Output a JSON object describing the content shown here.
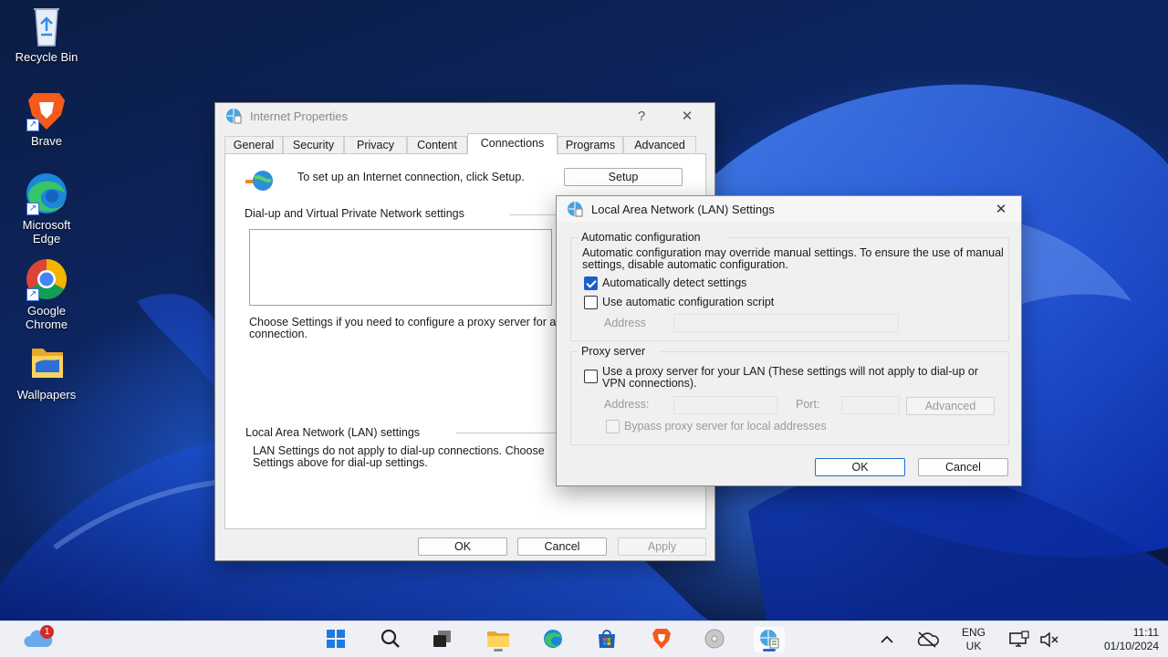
{
  "desktop": {
    "icons": [
      {
        "label": "Recycle Bin",
        "icon": "recycle-bin-icon"
      },
      {
        "label": "Brave",
        "icon": "brave-icon"
      },
      {
        "label": "Microsoft Edge",
        "icon": "edge-icon"
      },
      {
        "label": "Google Chrome",
        "icon": "chrome-icon"
      },
      {
        "label": "Wallpapers",
        "icon": "folder-icon"
      }
    ]
  },
  "internet_properties": {
    "title": "Internet Properties",
    "help": "?",
    "close": "✕",
    "tabs": [
      "General",
      "Security",
      "Privacy",
      "Content",
      "Connections",
      "Programs",
      "Advanced"
    ],
    "active_tab": "Connections",
    "setup_text": "To set up an Internet connection, click Setup.",
    "setup_button": "Setup",
    "dialup_heading": "Dial-up and Virtual Private Network settings",
    "proxy_hint": "Choose Settings if you need to configure a proxy server for a connection.",
    "lan_heading": "Local Area Network (LAN) settings",
    "lan_note": "LAN Settings do not apply to dial-up connections. Choose Settings above for dial-up settings.",
    "ok": "OK",
    "cancel": "Cancel",
    "apply": "Apply"
  },
  "lan_settings": {
    "title": "Local Area Network (LAN) Settings",
    "close": "✕",
    "auto_config_heading": "Automatic configuration",
    "auto_config_desc": "Automatic configuration may override manual settings.  To ensure the use of manual settings, disable automatic configuration.",
    "auto_detect_label": "Automatically detect settings",
    "auto_detect_checked": true,
    "auto_script_label": "Use automatic configuration script",
    "auto_script_checked": false,
    "address_label": "Address",
    "proxy_heading": "Proxy server",
    "use_proxy_label": "Use a proxy server for your LAN (These settings will not apply to dial-up or VPN connections).",
    "use_proxy_checked": false,
    "proxy_address_label": "Address:",
    "port_label": "Port:",
    "advanced_button": "Advanced",
    "bypass_label": "Bypass proxy server for local addresses",
    "ok": "OK",
    "cancel": "Cancel"
  },
  "taskbar": {
    "weather_badge": "1",
    "language_line1": "ENG",
    "language_line2": "UK",
    "time": "11:11",
    "date": "01/10/2024"
  },
  "colors": {
    "accent": "#1a5fc8",
    "dialog_bg": "#f0f0f0",
    "taskbar_bg": "#eef0f6"
  }
}
